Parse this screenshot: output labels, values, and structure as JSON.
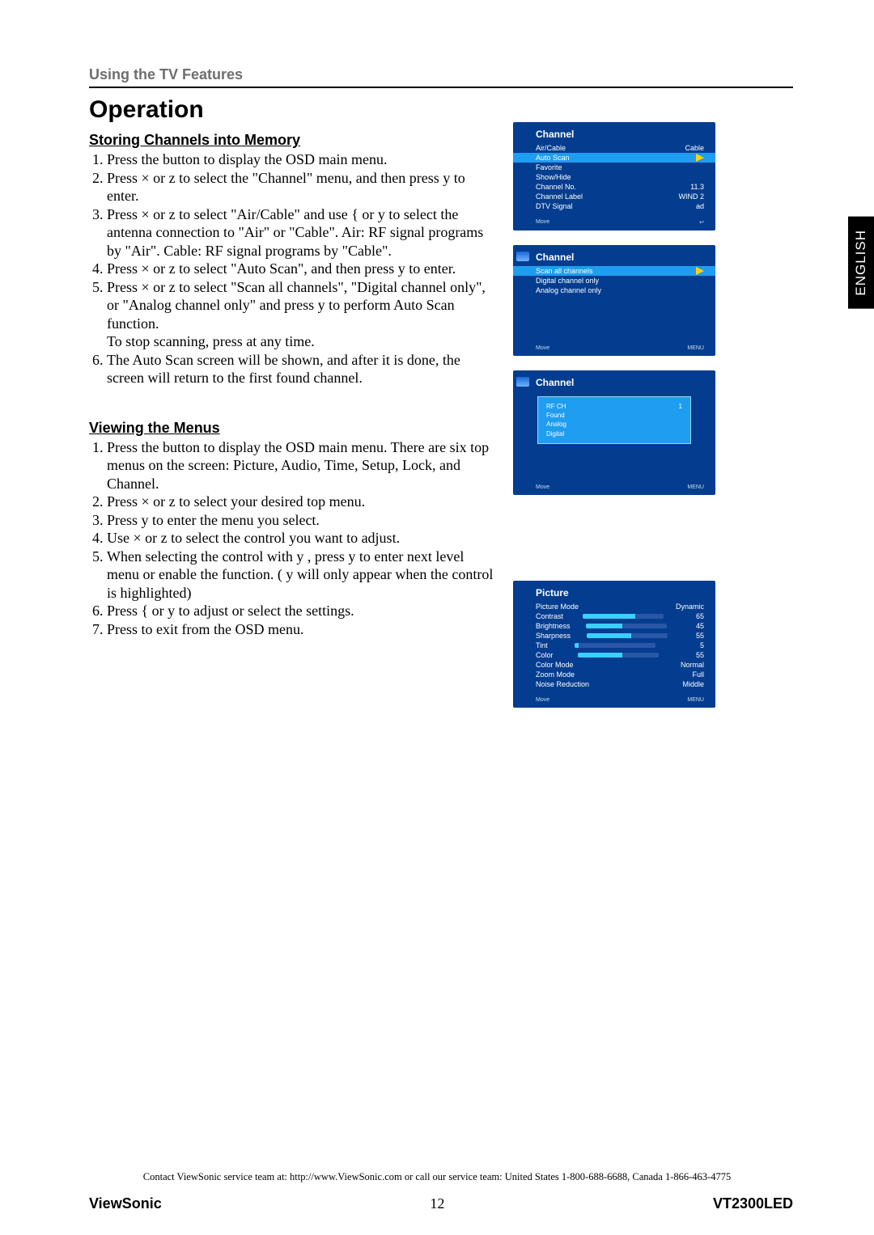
{
  "sectionTab": "Using the TV Features",
  "heading": "Operation",
  "sidetab": "ENGLISH",
  "storing": {
    "title": "Storing Channels into Memory",
    "s1": "Press the             button to display the OSD main menu.",
    "s2": "Press  ×  or  z  to select the \"Channel\" menu, and then press  y  to enter.",
    "s3": "Press  ×  or  z  to select \"Air/Cable\" and use        {  or  y  to select the antenna connection to \"Air\" or \"Cable\". Air: RF signal programs by \"Air\". Cable: RF signal programs by \"Cable\".",
    "s4": "Press  ×  or  z  to select \"Auto Scan\", and then press       y  to enter.",
    "s5a": "Press  ×  or  z  to select \"Scan all channels\", \"Digital channel only\", or \"Analog channel only\" and press        y  to perform Auto Scan function.",
    "s5b": "To stop scanning, press             at any time.",
    "s6": "The Auto Scan screen will be shown, and after it is done, the screen will return to the first found channel."
  },
  "viewing": {
    "title": "Viewing the Menus",
    "s1": "Press the              button to display the OSD main menu. There are six top menus on the screen: Picture, Audio, Time, Setup, Lock, and Channel.",
    "s2": "Press  ×  or  z  to select your desired top menu.",
    "s3": "Press  y  to enter the menu you select.",
    "s4": "Use  ×  or  z  to select the control you want to adjust.",
    "s5": "When selecting the control with  y , press  y  to enter next level menu or enable the function. ( y  will only appear when the control is highlighted)",
    "s6": "Press  {  or  y  to adjust or select the settings.",
    "s7": "Press           to exit from the OSD menu."
  },
  "osd_channel": {
    "title": "Channel",
    "rows": [
      {
        "l": "Air/Cable",
        "r": "Cable"
      },
      {
        "l": "Auto Scan",
        "r": ""
      },
      {
        "l": "Favorite",
        "r": ""
      },
      {
        "l": "Show/Hide",
        "r": ""
      },
      {
        "l": "Channel No.",
        "r": "11.3"
      },
      {
        "l": "Channel Label",
        "r": "WIND 2"
      },
      {
        "l": "DTV Signal",
        "r": "ad"
      }
    ],
    "foot_l": "Move",
    "foot_r": "Return"
  },
  "osd_scanmenu": {
    "title": "Channel",
    "rows": [
      "Scan all channels",
      "Digital channel only",
      "Analog channel only"
    ],
    "foot_l": "Move",
    "foot_r": "MENU"
  },
  "osd_scanprog": {
    "title": "Channel",
    "rows": [
      {
        "l": "RF CH",
        "r": "1"
      },
      {
        "l": "Found",
        "r": ""
      },
      {
        "l": "Analog",
        "r": ""
      },
      {
        "l": "Digital",
        "r": ""
      }
    ],
    "foot_l": "Move",
    "foot_r": "MENU"
  },
  "osd_picture": {
    "title": "Picture",
    "rows": [
      {
        "l": "Picture Mode",
        "r": "Dynamic",
        "bar": null
      },
      {
        "l": "Contrast",
        "r": "65",
        "bar": 65
      },
      {
        "l": "Brightness",
        "r": "45",
        "bar": 45
      },
      {
        "l": "Sharpness",
        "r": "55",
        "bar": 55
      },
      {
        "l": "Tint",
        "r": "5",
        "bar": 5
      },
      {
        "l": "Color",
        "r": "55",
        "bar": 55
      },
      {
        "l": "Color Mode",
        "r": "Normal",
        "bar": null
      },
      {
        "l": "Zoom Mode",
        "r": "Full",
        "bar": null
      },
      {
        "l": "Noise Reduction",
        "r": "Middle",
        "bar": null
      }
    ],
    "foot_l": "Move",
    "foot_r": "MENU"
  },
  "contact": "Contact ViewSonic service team at: http://www.ViewSonic.com or call our service team: United States 1-800-688-6688, Canada 1-866-463-4775",
  "footer": {
    "brand": "ViewSonic",
    "page": "12",
    "model": "VT2300LED"
  },
  "icons": {
    "return": "↩"
  }
}
